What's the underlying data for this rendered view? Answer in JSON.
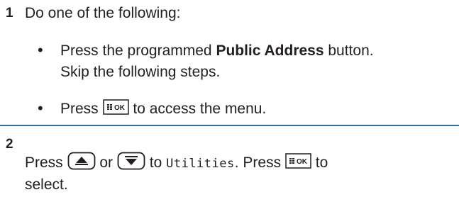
{
  "step1": {
    "number": "1",
    "intro": "Do one of the following:",
    "bullet_glyph": "•",
    "bullet1": {
      "prefix": "Press the programmed ",
      "bold": "Public Address",
      "suffix": " button.",
      "line2": "Skip the following steps."
    },
    "bullet2": {
      "prefix": "Press",
      "key": "menu-ok-key",
      "suffix": "to access the menu."
    }
  },
  "step2": {
    "number": "2",
    "press1": "Press",
    "key_up": "up-arrow-key",
    "or": "or",
    "key_down": "down-arrow-key",
    "to": "to",
    "menu_item": "Utilities",
    "press2": ". Press",
    "key_ok": "menu-ok-key",
    "to2": "to",
    "line2": "select."
  },
  "key_labels": {
    "menu_ok": "OK"
  },
  "colors": {
    "divider": "#2f6fa7",
    "text": "#231f20"
  }
}
